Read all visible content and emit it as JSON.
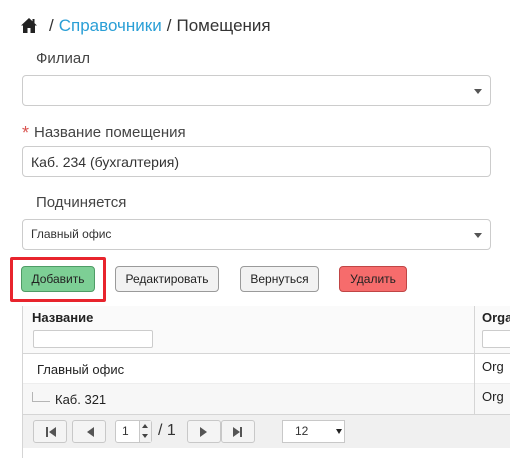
{
  "breadcrumb": {
    "icon": "home-icon",
    "link": "Справочники",
    "current": "Помещения",
    "separator": "/"
  },
  "form": {
    "branch_label": "Филиал",
    "branch_value": "",
    "name_label": "Название помещения",
    "name_required_mark": "*",
    "name_value": "Каб. 234 (бухгалтерия)",
    "parent_label": "Подчиняется",
    "parent_value": "Главный офис"
  },
  "buttons": {
    "add": "Добавить",
    "edit": "Редактировать",
    "back": "Вернуться",
    "delete": "Удалить"
  },
  "grid": {
    "columns": [
      "Название",
      "Orga"
    ],
    "rows": [
      {
        "name": "Главный офис",
        "org": "Org"
      },
      {
        "name": "Каб. 321",
        "org": "Org"
      }
    ]
  },
  "pager": {
    "page": "1",
    "total": "/ 1",
    "page_size": "12"
  },
  "colors": {
    "link": "#2a9fd6",
    "add_button": "#7dcf95",
    "delete_button": "#f66c6c",
    "highlight": "#e8242d",
    "required": "#d9534f"
  }
}
